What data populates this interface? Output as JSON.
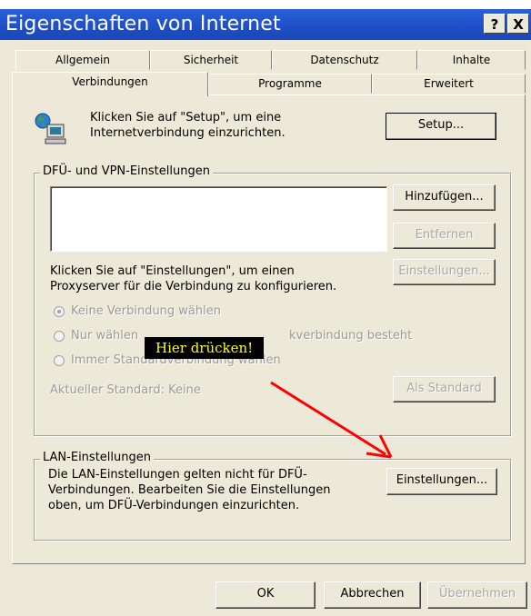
{
  "window": {
    "title": "Eigenschaften von Internet"
  },
  "titlebar_buttons": {
    "help": "?",
    "close": "X"
  },
  "tabs": {
    "row1": [
      "Allgemein",
      "Sicherheit",
      "Datenschutz",
      "Inhalte"
    ],
    "row2": [
      "Verbindungen",
      "Programme",
      "Erweitert"
    ],
    "active": "Verbindungen"
  },
  "setup": {
    "text_line1": "Klicken Sie auf \"Setup\", um eine",
    "text_line2": "Internetverbindung einzurichten.",
    "button": "Setup..."
  },
  "dialup": {
    "legend": "DFÜ- und VPN-Einstellungen",
    "add_button": "Hinzufügen...",
    "remove_button": "Entfernen",
    "settings_button": "Einstellungen...",
    "proxy_text_line1": "Klicken Sie auf \"Einstellungen\", um einen",
    "proxy_text_line2": "Proxyserver für die Verbindung zu konfigurieren.",
    "radio_none": "Keine Verbindung wählen",
    "radio_when_no_net_prefix": "Nur wählen",
    "radio_when_no_net_suffix": "kverbindung besteht",
    "radio_always": "Immer Standardverbindung wählen",
    "current_default": "Aktueller Standard:  Keine",
    "default_button": "Als Standard"
  },
  "annotation": {
    "label": "Hier drücken!",
    "arrow_color": "#ff0000"
  },
  "lan": {
    "legend": "LAN-Einstellungen",
    "text_line1": "Die LAN-Einstellungen gelten nicht für DFÜ-",
    "text_line2": "Verbindungen. Bearbeiten Sie die Einstellungen",
    "text_line3": "oben, um DFÜ-Verbindungen einzurichten.",
    "button": "Einstellungen..."
  },
  "footer": {
    "ok": "OK",
    "cancel": "Abbrechen",
    "apply": "Übernehmen"
  }
}
